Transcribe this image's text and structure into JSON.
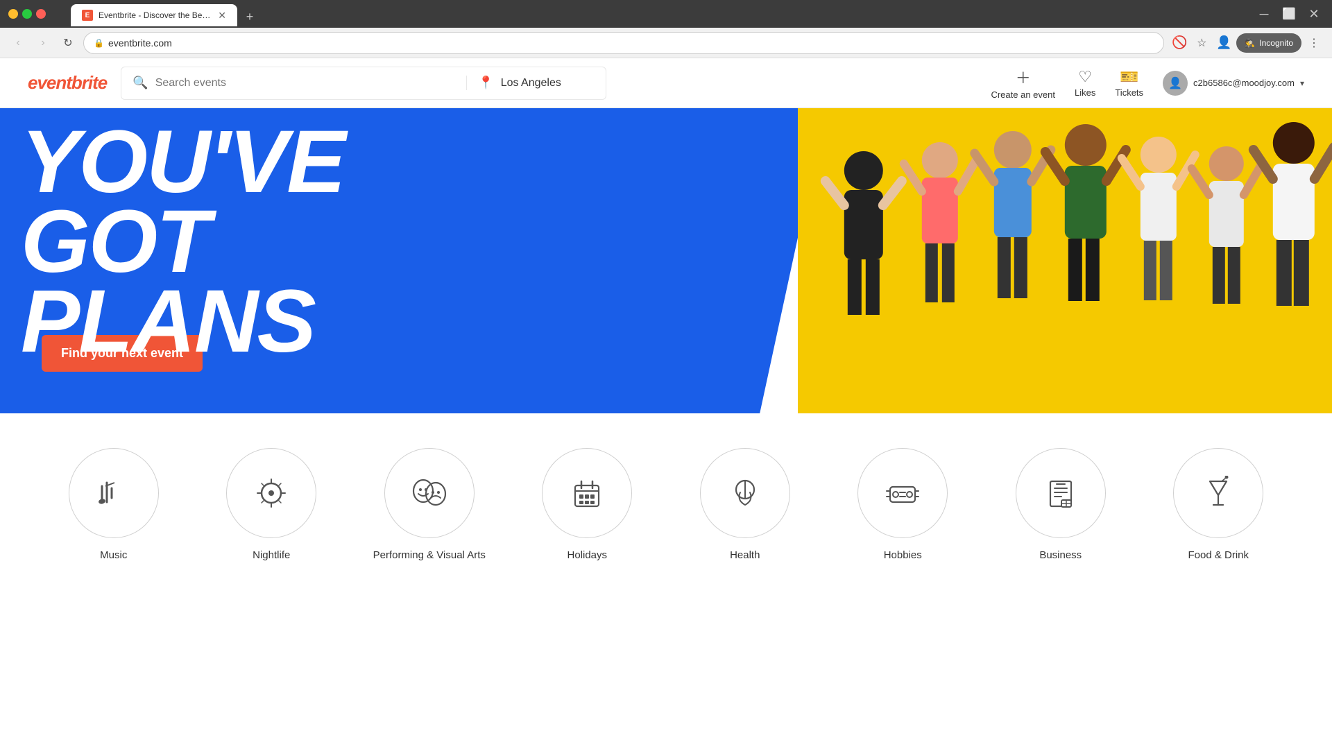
{
  "browser": {
    "tab_title": "Eventbrite - Discover the Best L...",
    "tab_favicon": "E",
    "url": "eventbrite.com",
    "new_tab_label": "+",
    "nav": {
      "back": "‹",
      "forward": "›",
      "refresh": "↻"
    },
    "incognito_label": "Incognito"
  },
  "header": {
    "logo": "eventbrite",
    "search_placeholder": "Search events",
    "location_value": "Los Angeles",
    "create_event_label": "Create an event",
    "likes_label": "Likes",
    "tickets_label": "Tickets",
    "user_email": "c2b6586c@moodjoy.com"
  },
  "hero": {
    "headline_line1": "YOU'VE",
    "headline_line2": "GOT",
    "headline_line3": "PLANS",
    "cta_label": "Find your next event",
    "bg_color": "#1a5ee8",
    "accent_color": "#f5c800"
  },
  "categories": {
    "items": [
      {
        "id": "music",
        "label": "Music",
        "icon": "🎤"
      },
      {
        "id": "nightlife",
        "label": "Nightlife",
        "icon": "🪩"
      },
      {
        "id": "performing-visual-arts",
        "label": "Performing & Visual Arts",
        "icon": "🎭"
      },
      {
        "id": "holidays",
        "label": "Holidays",
        "icon": "🎊"
      },
      {
        "id": "health",
        "label": "Health",
        "icon": "🩺"
      },
      {
        "id": "hobbies",
        "label": "Hobbies",
        "icon": "🎮"
      },
      {
        "id": "business",
        "label": "Business",
        "icon": "📋"
      },
      {
        "id": "food-drink",
        "label": "Food & Drink",
        "icon": "🍹"
      }
    ]
  }
}
